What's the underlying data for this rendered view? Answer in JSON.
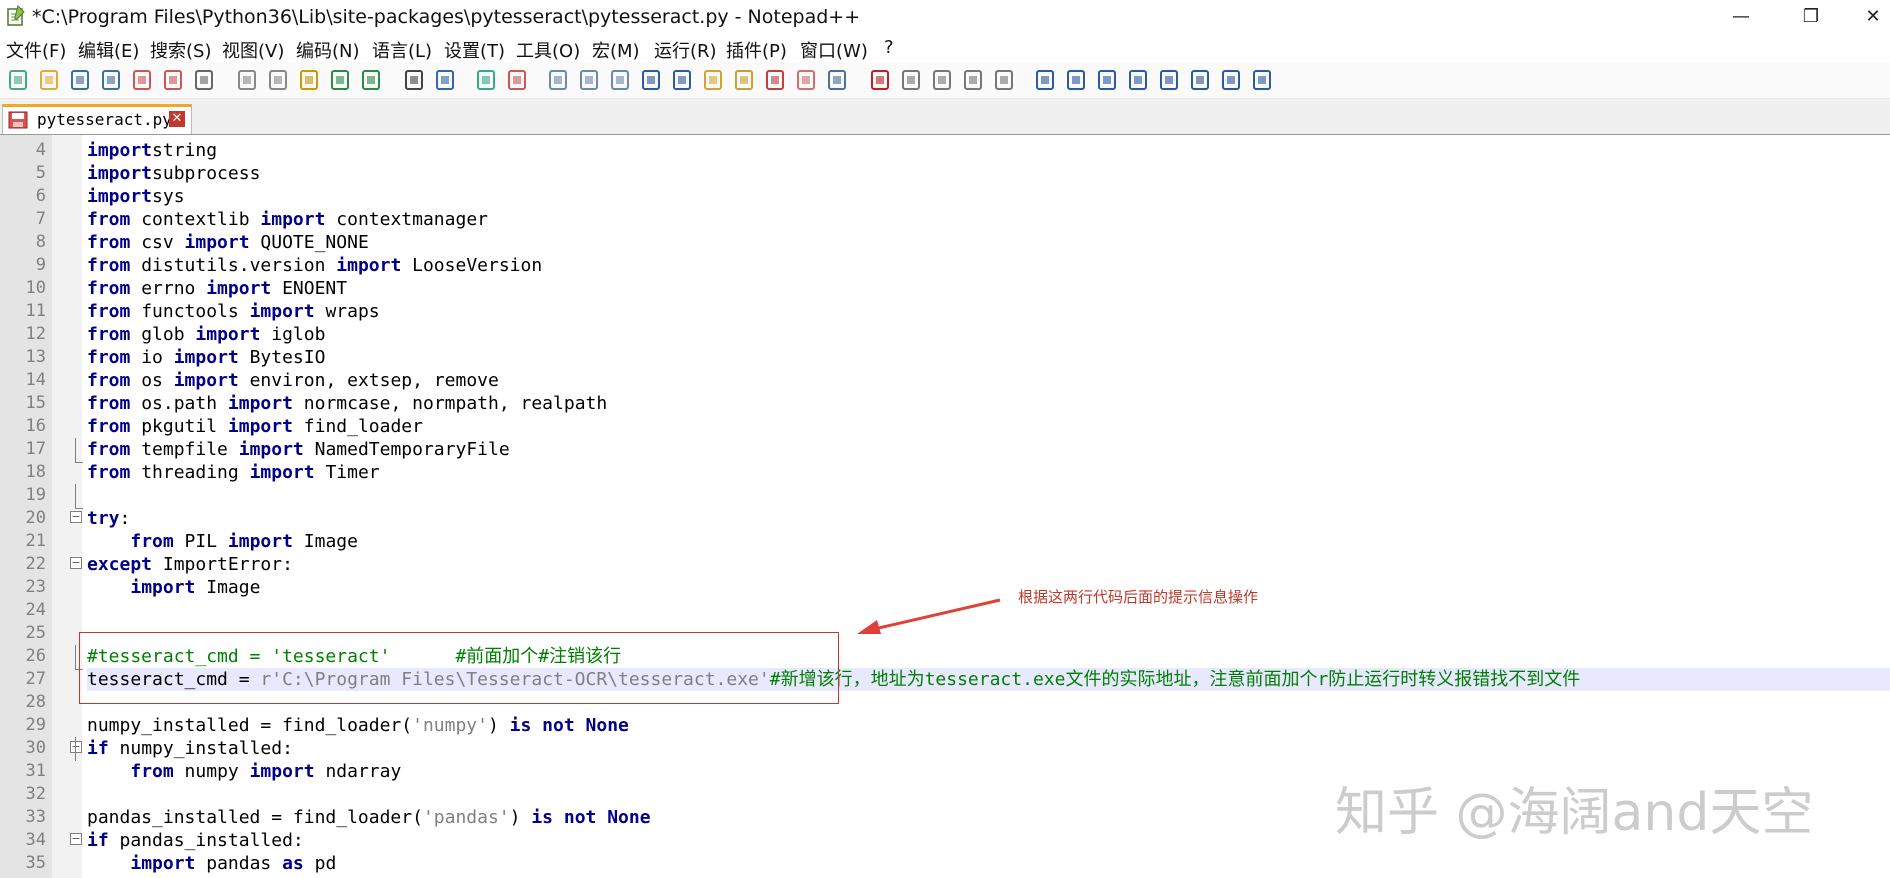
{
  "window": {
    "title": "*C:\\Program Files\\Python36\\Lib\\site-packages\\pytesseract\\pytesseract.py - Notepad++",
    "app_icon": "notepad-icon",
    "minimize_glyph": "—",
    "restore_glyph": "❐",
    "close_glyph": "✕"
  },
  "menu": [
    "文件(F)",
    "编辑(E)",
    "搜索(S)",
    "视图(V)",
    "编码(N)",
    "语言(L)",
    "设置(T)",
    "工具(O)",
    "宏(M)",
    "运行(R)",
    "插件(P)",
    "窗口(W)",
    "?"
  ],
  "toolbar_icons": [
    "new-file-icon",
    "open-file-icon",
    "save-icon",
    "save-all-icon",
    "close-icon",
    "close-all-icon",
    "print-icon",
    "cut-icon",
    "copy-icon",
    "paste-icon",
    "undo-icon",
    "redo-icon",
    "find-icon",
    "replace-icon",
    "zoom-in-icon",
    "zoom-out-icon",
    "sync-vertical-icon",
    "sync-horizontal-icon",
    "word-wrap-icon",
    "show-all-chars-icon",
    "indent-guide-icon",
    "folder-workspace-icon",
    "doc-map-icon",
    "function-list-icon",
    "folder-icon",
    "monitor-icon",
    "record-macro-icon",
    "stop-macro-icon",
    "play-macro-icon",
    "run-macro-multiple-icon",
    "save-macro-icon",
    "panel-icon-1",
    "panel-icon-2",
    "panel-icon-3",
    "panel-icon-4",
    "up-icon",
    "down-icon",
    "panel-icon-5",
    "panel-icon-6"
  ],
  "tab": {
    "name": "pytesseract.py",
    "close": "✕"
  },
  "lines": [
    {
      "n": "4",
      "t": [
        [
          "kw",
          "import"
        ],
        [
          "",
          "string"
        ]
      ]
    },
    {
      "n": "5",
      "t": [
        [
          "kw",
          "import"
        ],
        [
          "",
          "subprocess"
        ]
      ]
    },
    {
      "n": "6",
      "t": [
        [
          "kw",
          "import"
        ],
        [
          "",
          "sys"
        ]
      ]
    },
    {
      "n": "7",
      "t": [
        [
          "kw",
          "from"
        ],
        [
          "",
          " contextlib "
        ],
        [
          "kw",
          "import"
        ],
        [
          "",
          " contextmanager"
        ]
      ]
    },
    {
      "n": "8",
      "t": [
        [
          "kw",
          "from"
        ],
        [
          "",
          " csv "
        ],
        [
          "kw",
          "import"
        ],
        [
          "",
          " QUOTE_NONE"
        ]
      ]
    },
    {
      "n": "9",
      "t": [
        [
          "kw",
          "from"
        ],
        [
          "",
          " distutils.version "
        ],
        [
          "kw",
          "import"
        ],
        [
          "",
          " LooseVersion"
        ]
      ]
    },
    {
      "n": "10",
      "t": [
        [
          "kw",
          "from"
        ],
        [
          "",
          " errno "
        ],
        [
          "kw",
          "import"
        ],
        [
          "",
          " ENOENT"
        ]
      ]
    },
    {
      "n": "11",
      "t": [
        [
          "kw",
          "from"
        ],
        [
          "",
          " functools "
        ],
        [
          "kw",
          "import"
        ],
        [
          "",
          " wraps"
        ]
      ]
    },
    {
      "n": "12",
      "t": [
        [
          "kw",
          "from"
        ],
        [
          "",
          " glob "
        ],
        [
          "kw",
          "import"
        ],
        [
          "",
          " iglob"
        ]
      ]
    },
    {
      "n": "13",
      "t": [
        [
          "kw",
          "from"
        ],
        [
          "",
          " io "
        ],
        [
          "kw",
          "import"
        ],
        [
          "",
          " BytesIO"
        ]
      ]
    },
    {
      "n": "14",
      "t": [
        [
          "kw",
          "from"
        ],
        [
          "",
          " os "
        ],
        [
          "kw",
          "import"
        ],
        [
          "",
          " environ, extsep, remove"
        ]
      ]
    },
    {
      "n": "15",
      "t": [
        [
          "kw",
          "from"
        ],
        [
          "",
          " os.path "
        ],
        [
          "kw",
          "import"
        ],
        [
          "",
          " normcase, normpath, realpath"
        ]
      ]
    },
    {
      "n": "16",
      "t": [
        [
          "kw",
          "from"
        ],
        [
          "",
          " pkgutil "
        ],
        [
          "kw",
          "import"
        ],
        [
          "",
          " find_loader"
        ]
      ]
    },
    {
      "n": "17",
      "t": [
        [
          "kw",
          "from"
        ],
        [
          "",
          " tempfile "
        ],
        [
          "kw",
          "import"
        ],
        [
          "",
          " NamedTemporaryFile"
        ]
      ]
    },
    {
      "n": "18",
      "t": [
        [
          "kw",
          "from"
        ],
        [
          "",
          " threading "
        ],
        [
          "kw",
          "import"
        ],
        [
          "",
          " Timer"
        ]
      ]
    },
    {
      "n": "19",
      "t": []
    },
    {
      "n": "20",
      "t": [
        [
          "kw",
          "try"
        ],
        [
          "",
          ":"
        ]
      ]
    },
    {
      "n": "21",
      "t": [
        [
          "",
          "    "
        ],
        [
          "kw",
          "from"
        ],
        [
          "",
          " PIL "
        ],
        [
          "kw",
          "import"
        ],
        [
          "",
          " Image"
        ]
      ]
    },
    {
      "n": "22",
      "t": [
        [
          "kw",
          "except"
        ],
        [
          "",
          " ImportError:"
        ]
      ]
    },
    {
      "n": "23",
      "t": [
        [
          "",
          "    "
        ],
        [
          "kw",
          "import"
        ],
        [
          "",
          " Image"
        ]
      ]
    },
    {
      "n": "24",
      "t": []
    },
    {
      "n": "25",
      "t": []
    },
    {
      "n": "26",
      "t": [
        [
          "cmt",
          "#tesseract_cmd = 'tesseract'      #前面加个#注销该行"
        ]
      ]
    },
    {
      "n": "27",
      "t": [
        [
          "",
          "tesseract_cmd = "
        ],
        [
          "str",
          "r'C:\\Program Files\\Tesseract-OCR\\tesseract.exe'"
        ],
        [
          "cmt",
          "#新增该行，地址为tesseract.exe文件的实际地址，注意前面加个r防止运行时转义报错找不到文件"
        ]
      ]
    },
    {
      "n": "28",
      "t": []
    },
    {
      "n": "29",
      "t": [
        [
          "",
          "numpy_installed = find_loader("
        ],
        [
          "str",
          "'numpy'"
        ],
        [
          "",
          ") "
        ],
        [
          "kw",
          "is not None"
        ]
      ]
    },
    {
      "n": "30",
      "t": [
        [
          "kw",
          "if"
        ],
        [
          "",
          " numpy_installed:"
        ]
      ]
    },
    {
      "n": "31",
      "t": [
        [
          "",
          "    "
        ],
        [
          "kw",
          "from"
        ],
        [
          "",
          " numpy "
        ],
        [
          "kw",
          "import"
        ],
        [
          "",
          " ndarray"
        ]
      ]
    },
    {
      "n": "32",
      "t": []
    },
    {
      "n": "33",
      "t": [
        [
          "",
          "pandas_installed = find_loader("
        ],
        [
          "str",
          "'pandas'"
        ],
        [
          "",
          ") "
        ],
        [
          "kw",
          "is not None"
        ]
      ]
    },
    {
      "n": "34",
      "t": [
        [
          "kw",
          "if"
        ],
        [
          "",
          " pandas_installed:"
        ]
      ]
    },
    {
      "n": "35",
      "t": [
        [
          "",
          "    "
        ],
        [
          "kw",
          "import"
        ],
        [
          "",
          " pandas "
        ],
        [
          "kw",
          "as"
        ],
        [
          "",
          " pd"
        ]
      ]
    }
  ],
  "annotation": "根据这两行代码后面的提示信息操作",
  "watermark": "知乎 @海阔and天空"
}
